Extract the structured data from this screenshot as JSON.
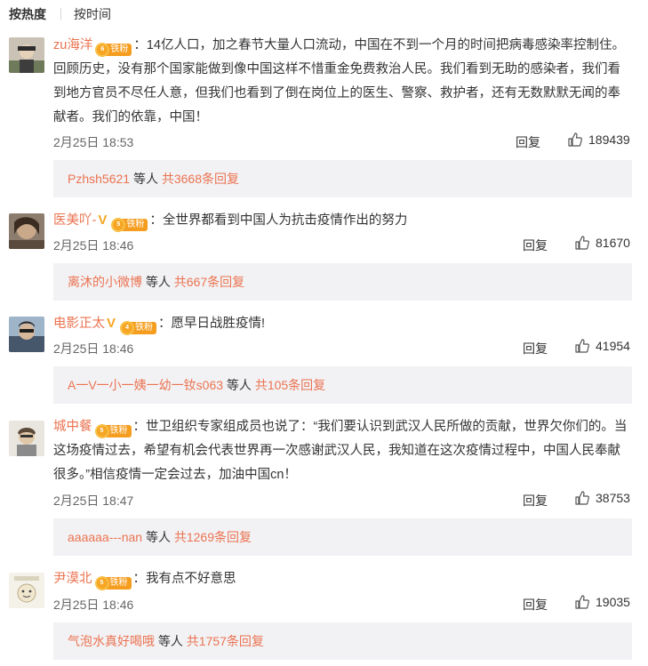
{
  "sort": {
    "active": "按热度",
    "inactive": "按时间"
  },
  "comments": [
    {
      "username": "zu海洋",
      "vip": false,
      "badge_level": "6",
      "badge_label": "铁粉",
      "text": "：14亿人口，加之春节大量人口流动，中国在不到一个月的时间把病毒感染率控制住。回顾历史，没有那个国家能做到像中国这样不惜重金免费救治人民。我们看到无助的感染者，我们看到地方官员不尽任人意，但我们也看到了倒在岗位上的医生、警察、救护者，还有无数默默无闻的奉献者。我们的依靠，中国！",
      "time": "2月25日 18:53",
      "reply_label": "回复",
      "likes": "189439",
      "reply_users": "Pzhsh5621",
      "reply_mid": " 等人 ",
      "reply_count": "共3668条回复"
    },
    {
      "username": "医美吖-",
      "vip": true,
      "badge_level": "5",
      "badge_label": "铁粉",
      "text": "：全世界都看到中国人为抗击疫情作出的努力",
      "time": "2月25日 18:46",
      "reply_label": "回复",
      "likes": "81670",
      "reply_users": "离沐的小微博",
      "reply_mid": " 等人 ",
      "reply_count": "共667条回复"
    },
    {
      "username": "电影正太",
      "vip": true,
      "badge_level": "4",
      "badge_label": "铁粉",
      "text": "：愿早日战胜疫情!",
      "time": "2月25日 18:46",
      "reply_label": "回复",
      "likes": "41954",
      "reply_users": "A一V一小一姨一幼一钕s063",
      "reply_mid": " 等人 ",
      "reply_count": "共105条回复"
    },
    {
      "username": "城中餐",
      "vip": false,
      "badge_level": "5",
      "badge_label": "铁粉",
      "text": "：世卫组织专家组成员也说了：“我们要认识到武汉人民所做的贡献，世界欠你们的。当这场疫情过去，希望有机会代表世界再一次感谢武汉人民，我知道在这次疫情过程中，中国人民奉献很多。”相信疫情一定会过去，加油中国cn！",
      "time": "2月25日 18:47",
      "reply_label": "回复",
      "likes": "38753",
      "reply_users": "aaaaaa---nan",
      "reply_mid": " 等人 ",
      "reply_count": "共1269条回复"
    },
    {
      "username": "尹漠北",
      "vip": false,
      "badge_level": "5",
      "badge_label": "铁粉",
      "text": "：我有点不好意思",
      "time": "2月25日 18:46",
      "reply_label": "回复",
      "likes": "19035",
      "reply_users": "气泡水真好喝哦",
      "reply_mid": " 等人 ",
      "reply_count": "共1757条回复"
    }
  ]
}
